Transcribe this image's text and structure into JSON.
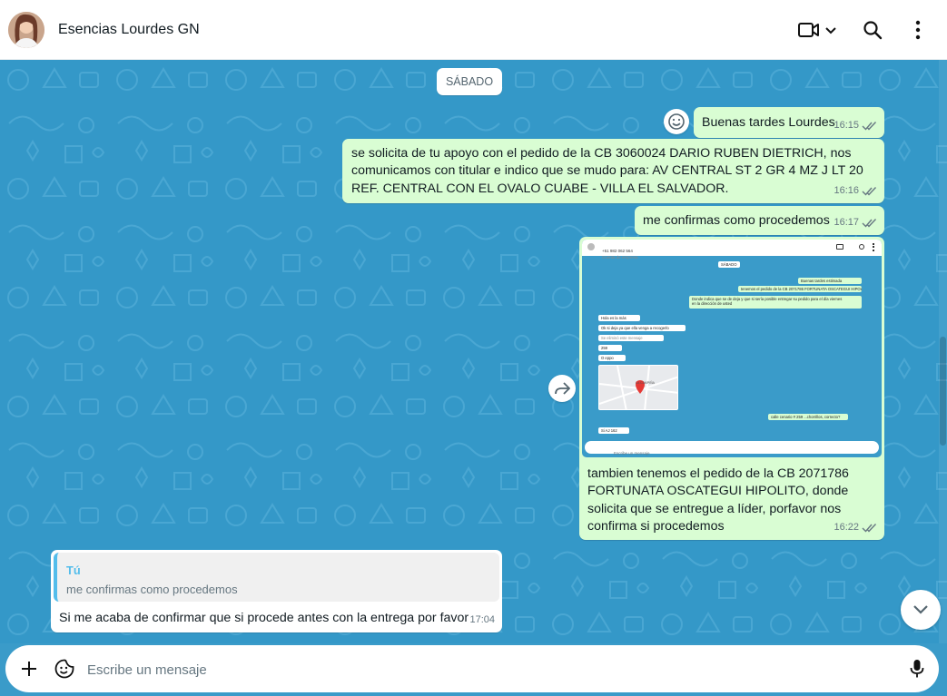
{
  "header": {
    "contact_name": "Esencias Lourdes GN"
  },
  "chat": {
    "date_chip": "SÁBADO",
    "messages": [
      {
        "dir": "out",
        "text": "Buenas tardes Lourdes",
        "time": "16:15"
      },
      {
        "dir": "out",
        "text": "se solicita de tu apoyo con el pedido de la CB 3060024 DARIO RUBEN DIETRICH, nos comunicamos con titular e indico que se mudo para: AV CENTRAL ST 2 GR 4 MZ J LT 20 REF. CENTRAL CON EL OVALO CUABE -  VILLA EL SALVADOR.",
        "time": "16:16"
      },
      {
        "dir": "out",
        "text": "me confirmas como procedemos",
        "time": "16:17"
      },
      {
        "dir": "out",
        "text": "tambien tenemos el pedido de la CB 2071786 FORTUNATA OSCATEGUI HIPOLITO, donde solicita que se entregue a líder, porfavor nos confirma si procedemos",
        "time": "16:22"
      },
      {
        "dir": "in",
        "quote_author": "Tú",
        "quote_text": "me confirmas como procedemos",
        "text": "Si me acaba de confirmar que si procede antes con la entrega por favor",
        "time": "17:04"
      }
    ],
    "image_shot": {
      "header_phone": "+51 982 062 564",
      "header_sub": "Cuenta de empresa",
      "date": "SÁBADO",
      "m1": "Buenas tardes estimada",
      "m2": "tenemos el pedido de la CB 2071786 FORTUNATA OSCATEGUI HIPOLITO",
      "m3a": "Donde indica que se de deja y que si sería posible entregar su pedido para el día viernes",
      "m3b": "en la dirección de usted",
      "r1": "Hola es la más",
      "r2": "Ok si deja ya que ella venga a recogerlo",
      "r3": "Se eliminó este mensaje",
      "r4": "259",
      "r5": "O eppo",
      "map_label": "LA CAMPIÑA",
      "m4": "calle cenario # 259 ...chorrillos, correcto?",
      "r6": "Si AJ 162",
      "composer": "Escribe un mensaje"
    }
  },
  "composer": {
    "placeholder": "Escribe un mensaje"
  }
}
